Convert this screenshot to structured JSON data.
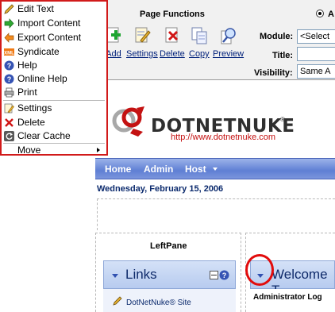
{
  "control_panel": {
    "title": "Page Functions",
    "tools": [
      {
        "label": "Add",
        "icon": "add-icon"
      },
      {
        "label": "Settings",
        "icon": "settings-icon"
      },
      {
        "label": "Delete",
        "icon": "delete-icon"
      },
      {
        "label": "Copy",
        "icon": "copy-icon"
      },
      {
        "label": "Preview",
        "icon": "preview-icon"
      }
    ],
    "radio_label": "A",
    "module_label": "Module:",
    "module_value": "<Select",
    "title_label": "Title:",
    "title_value": "",
    "visibility_label": "Visibility:",
    "visibility_value": "Same A"
  },
  "logo": {
    "name": "DOTNETNUKE",
    "url": "http://www.dotnetnuke.com",
    "registered": "®"
  },
  "nav": {
    "items": [
      "Home",
      "Admin",
      "Host"
    ]
  },
  "date": "Wednesday, February 15, 2006",
  "panes": {
    "left_pane_label": "LeftPane"
  },
  "links_module": {
    "title": "Links",
    "link_text": "DotNetNuke® Site"
  },
  "welcome_module": {
    "title": "Welcome T",
    "body_text": "Administrator Log"
  },
  "action_menu": {
    "items": [
      {
        "label": "Edit Text",
        "icon": "edit-pencil-icon"
      },
      {
        "label": "Import Content",
        "icon": "import-arrow-icon"
      },
      {
        "label": "Export Content",
        "icon": "export-arrow-icon"
      },
      {
        "label": "Syndicate",
        "icon": "xml-icon"
      },
      {
        "label": "Help",
        "icon": "help-icon"
      },
      {
        "label": "Online Help",
        "icon": "online-help-icon"
      },
      {
        "label": "Print",
        "icon": "print-icon"
      },
      {
        "label": "Settings",
        "icon": "settings-icon"
      },
      {
        "label": "Delete",
        "icon": "delete-x-icon"
      },
      {
        "label": "Clear Cache",
        "icon": "refresh-icon"
      },
      {
        "label": "Move",
        "icon": ""
      }
    ]
  },
  "colors": {
    "menu_border": "#d11a1a",
    "highlight_circle": "#e20c0c",
    "nav_blue": "#5f7fd4",
    "logo_red": "#c41212"
  }
}
